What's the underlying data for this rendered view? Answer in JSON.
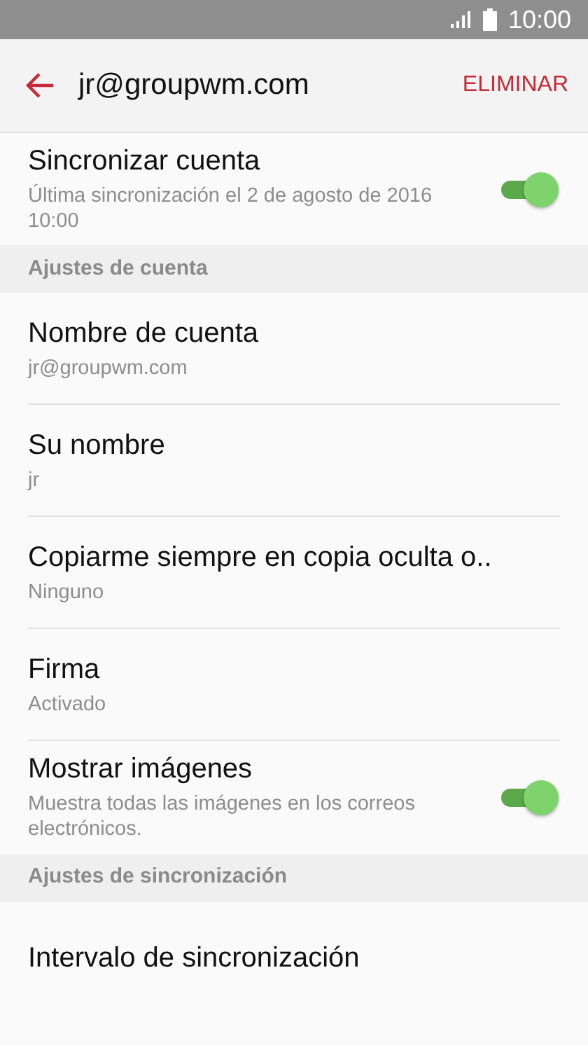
{
  "status_bar": {
    "time": "10:00"
  },
  "header": {
    "title": "jr@groupwm.com",
    "action": "ELIMINAR"
  },
  "items": [
    {
      "kind": "toggle",
      "title": "Sincronizar cuenta",
      "subtitle": "Última sincronización el 2 de agosto de 2016 10:00",
      "on": true
    },
    {
      "kind": "section",
      "title": "Ajustes de cuenta"
    },
    {
      "kind": "setting",
      "title": "Nombre de cuenta",
      "subtitle": "jr@groupwm.com"
    },
    {
      "kind": "setting",
      "title": "Su nombre",
      "subtitle": "jr"
    },
    {
      "kind": "setting",
      "title": "Copiarme siempre en copia oculta o..",
      "subtitle": "Ninguno"
    },
    {
      "kind": "setting",
      "title": "Firma",
      "subtitle": "Activado"
    },
    {
      "kind": "toggle",
      "title": "Mostrar imágenes",
      "subtitle": "Muestra todas las imágenes en los correos electrónicos.",
      "on": true
    },
    {
      "kind": "section",
      "title": "Ajustes de sincronización"
    },
    {
      "kind": "setting",
      "title": "Intervalo de sincronización"
    }
  ]
}
